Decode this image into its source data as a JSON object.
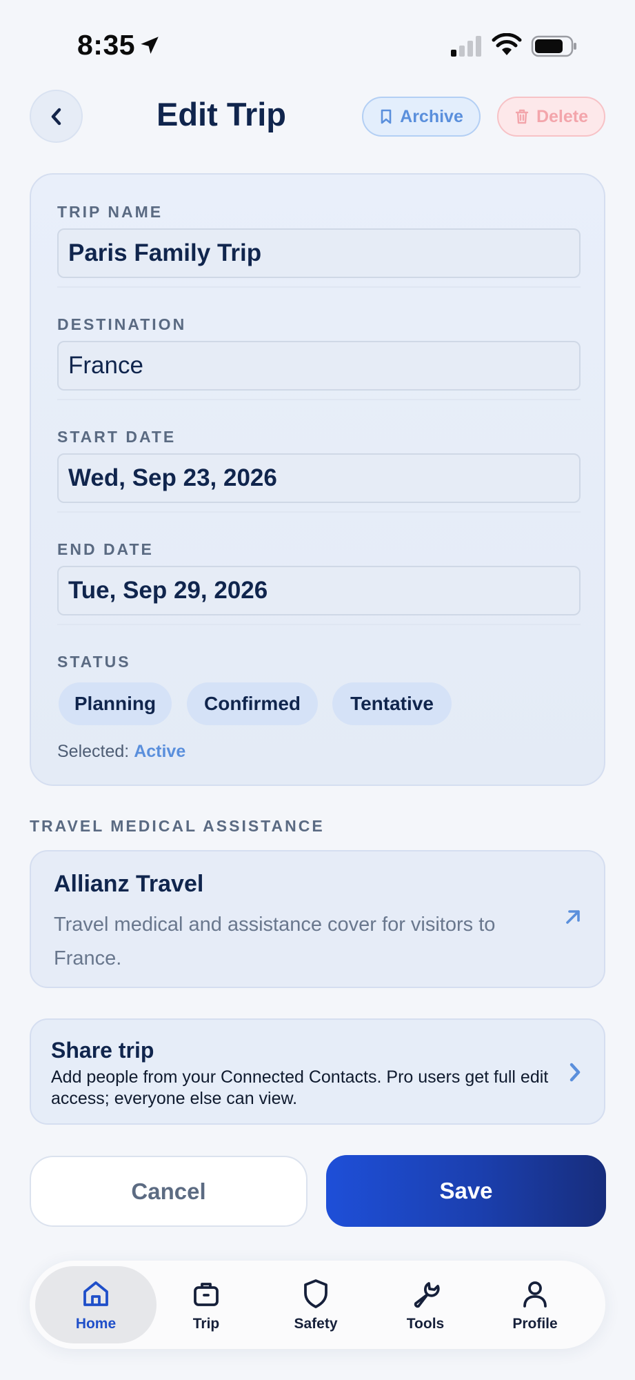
{
  "status_bar": {
    "time": "8:35"
  },
  "header": {
    "title": "Edit Trip",
    "archive_label": "Archive",
    "delete_label": "Delete"
  },
  "form": {
    "trip_name": {
      "label": "TRIP NAME",
      "value": "Paris Family Trip"
    },
    "destination": {
      "label": "DESTINATION",
      "value": "France"
    },
    "start_date": {
      "label": "START DATE",
      "value": "Wed, Sep 23, 2026"
    },
    "end_date": {
      "label": "END DATE",
      "value": "Tue, Sep 29, 2026"
    },
    "status": {
      "label": "STATUS",
      "options": [
        "Planning",
        "Confirmed",
        "Tentative"
      ],
      "selected_prefix": "Selected:",
      "selected_value": "Active"
    }
  },
  "medical": {
    "section_heading": "TRAVEL MEDICAL ASSISTANCE",
    "provider": "Allianz Travel",
    "description": "Travel medical and assistance cover for visitors to France."
  },
  "share": {
    "title": "Share trip",
    "description": "Add people from your Connected Contacts. Pro users get full edit access; everyone else can view."
  },
  "actions": {
    "cancel_label": "Cancel",
    "save_label": "Save"
  },
  "tabbar": {
    "items": [
      {
        "label": "Home",
        "icon": "home-icon",
        "active": true
      },
      {
        "label": "Trip",
        "icon": "briefcase-icon",
        "active": false
      },
      {
        "label": "Safety",
        "icon": "shield-icon",
        "active": false
      },
      {
        "label": "Tools",
        "icon": "wrench-icon",
        "active": false
      },
      {
        "label": "Profile",
        "icon": "user-icon",
        "active": false
      }
    ]
  },
  "colors": {
    "accent": "#1f4fc9",
    "archive": "#5a8fdc",
    "delete": "#f3a5ab",
    "title": "#10254d"
  }
}
